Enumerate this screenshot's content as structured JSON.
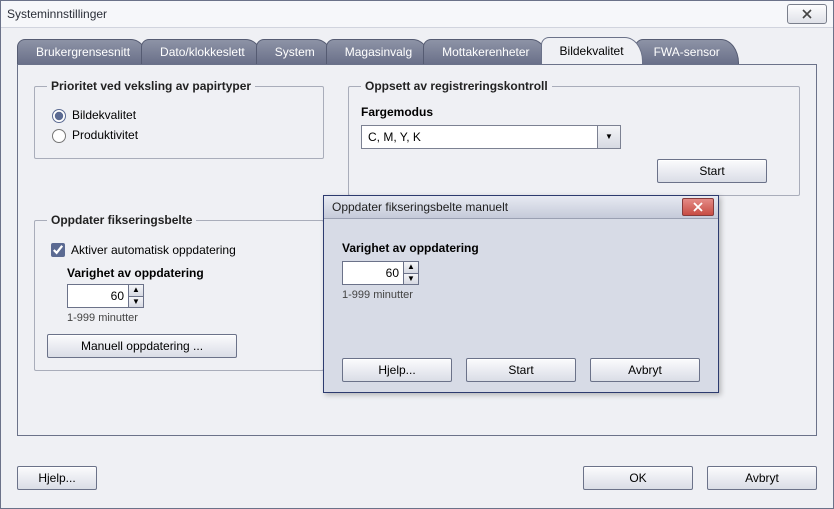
{
  "window": {
    "title": "Systeminnstillinger"
  },
  "tabs": [
    {
      "label": "Brukergrensesnitt",
      "active": false
    },
    {
      "label": "Dato/klokkeslett",
      "active": false
    },
    {
      "label": "System",
      "active": false
    },
    {
      "label": "Magasinvalg",
      "active": false
    },
    {
      "label": "Mottakerenheter",
      "active": false
    },
    {
      "label": "Bildekvalitet",
      "active": true
    },
    {
      "label": "FWA-sensor",
      "active": false
    }
  ],
  "priority": {
    "legend": "Prioritet ved veksling av papirtyper",
    "option_quality": "Bildekvalitet",
    "option_productivity": "Produktivitet",
    "selected": "quality"
  },
  "registration": {
    "legend": "Oppsett av registreringskontroll",
    "color_mode_label": "Fargemodus",
    "color_mode_value": "C, M, Y, K",
    "start_label": "Start"
  },
  "fuser_refresh": {
    "legend": "Oppdater fikseringsbelte",
    "auto_checkbox_label": "Aktiver automatisk oppdatering",
    "auto_checked": true,
    "duration_label": "Varighet av oppdatering",
    "duration_value": "60",
    "duration_hint": "1-999 minutter",
    "manual_button_label": "Manuell oppdatering ..."
  },
  "manual_dialog": {
    "title": "Oppdater fikseringsbelte manuelt",
    "duration_label": "Varighet av oppdatering",
    "duration_value": "60",
    "duration_hint": "1-999 minutter",
    "help_label": "Hjelp...",
    "start_label": "Start",
    "cancel_label": "Avbryt"
  },
  "bottom": {
    "help_label": "Hjelp...",
    "ok_label": "OK",
    "cancel_label": "Avbryt"
  }
}
